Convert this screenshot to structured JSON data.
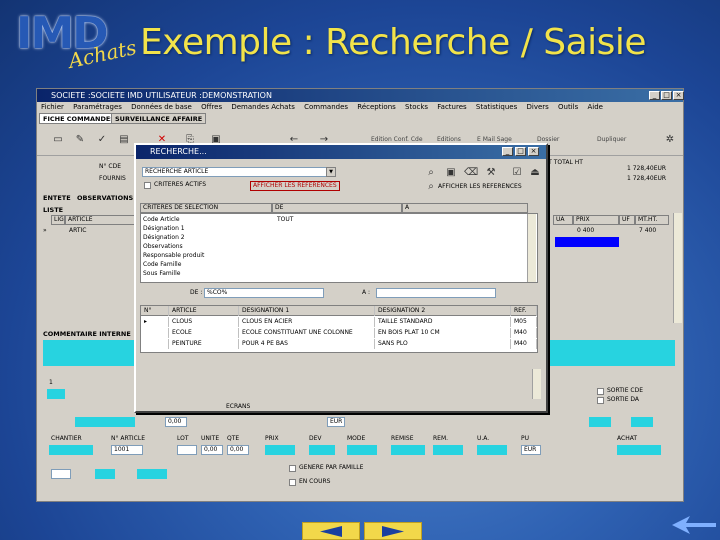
{
  "slide": {
    "title": "Exemple : Recherche / Saisie",
    "logo_text": "IMD",
    "logo_script": "Achats"
  },
  "app": {
    "window_title": "SOCIETE :SOCIETE IMD UTILISATEUR :DEMONSTRATION",
    "menu": [
      "Fichier",
      "Paramétrages",
      "Données de base",
      "Offres",
      "Demandes Achats",
      "Commandes",
      "Réceptions",
      "Stocks",
      "Factures",
      "Statistiques",
      "Divers",
      "Outils",
      "Aide"
    ],
    "tabs": [
      "FICHE COMMANDES",
      "SURVEILLANCE AFFAIRE"
    ],
    "toolbar_labels": [
      "Edition Conf. Cde",
      "Editions",
      "E Mail Sage",
      "Dossier",
      "Dupliquer"
    ],
    "labels": {
      "n_cde": "N° CDE",
      "fournis": "FOURNIS",
      "entete": "ENTETE",
      "observations": "OBSERVATIONS",
      "liste": "LISTE",
      "commentaire": "COMMENTAIRE INTERNE",
      "mt_total": "MT TOTAL HT",
      "total1": "1 728,40EUR",
      "total2": "1 728,40EUR",
      "lig": "LIG",
      "article": "ARTICLE",
      "col_ua": "UA",
      "col_prix": "PRIX",
      "col_uf": "UF",
      "col_mtht": "MT.HT.",
      "row1_article": "ARTIC",
      "row1_prix": "0 400",
      "row1_mt": "7 400"
    },
    "bottom_labels": [
      "CHANTIER",
      "N° ARTICLE",
      "LOT",
      "UNITE",
      "QTE",
      "PRIX",
      "DEV",
      "MODE",
      "REMISE",
      "REM.",
      "U.A.",
      "PU",
      "ACHAT"
    ],
    "bottom_values": {
      "qte": "1",
      "u1": "0,00",
      "u2": "0,00",
      "u3": "0,00",
      "u4": "1001",
      "dev": "EUR",
      "dev2": "EUR"
    },
    "checks": {
      "sortie_cde": "SORTIE CDE",
      "sortie_da": "SORTIE DA",
      "encours": "EN COURS",
      "genere": "GENERE PAR FAMILLE"
    }
  },
  "search_modal": {
    "title": "RECHERCHE...",
    "field_label": "RECHERCHE ARTICLE",
    "criteria_label": "CRITERES ACTIFS",
    "display_label": "AFFICHER LES REFERENCES",
    "criteria_header": "CRITERES DE SELECTION",
    "criteria_col2": "DE",
    "criteria_col3": "A",
    "criteria": [
      "Code Article",
      "Désignation 1",
      "Désignation 2",
      "Observations",
      "Responsable produit",
      "Code Famille",
      "Sous Famille"
    ],
    "first_value": "TOUT",
    "filter_de_label": "DE :",
    "filter_de_value": "%CO%",
    "filter_a_label": "A :",
    "result_columns": [
      "N°",
      "ARTICLE",
      "DESIGNATION 1",
      "DESIGNATION 2",
      "REF."
    ],
    "results": [
      {
        "article": "CLOUS",
        "des1": "CLOUS EN ACIER",
        "des2": "TAILLE STANDARD",
        "ref": "M05"
      },
      {
        "article": "ECOLE",
        "des1": "ECOLE CONSTITUANT UNE COLONNE",
        "des2": "EN BOIS PLAT 10 CM",
        "ref": "M40"
      },
      {
        "article": "PEINTURE",
        "des1": "POUR 4 PE BAS",
        "des2": "SANS PLO",
        "ref": "M40"
      }
    ],
    "footer_label": "ECRANS"
  },
  "colors": {
    "title_yellow": "#f2e34a",
    "field_cyan": "#27d3e0",
    "selection_blue": "#0000ff",
    "titlebar": "#0a246a"
  }
}
